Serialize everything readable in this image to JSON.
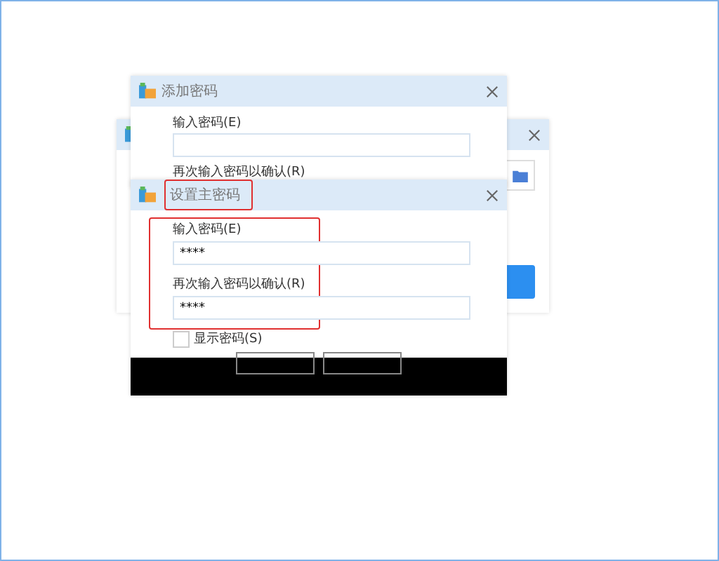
{
  "add_dialog": {
    "title": "添加密码",
    "fields": [
      {
        "label": "输入密码(E)",
        "kind": "input"
      },
      {
        "label": "再次输入密码以确认(R)",
        "kind": "label"
      }
    ]
  },
  "master_dialog": {
    "title": "设置主密码",
    "title_highlighted": true,
    "fields_highlighted": true,
    "fields": [
      {
        "label": "输入密码(E)",
        "value": "****"
      },
      {
        "label": "再次输入密码以确认(R)",
        "value": "****"
      }
    ],
    "show_password": {
      "label": "显示密码(S)",
      "checked": false
    },
    "buttons": [
      {
        "kind": "empty"
      },
      {
        "kind": "empty"
      }
    ]
  }
}
